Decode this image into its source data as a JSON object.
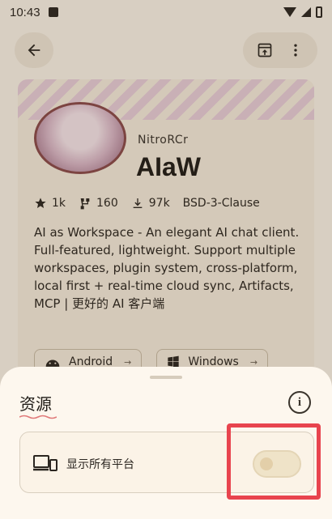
{
  "status_bar": {
    "time": "10:43",
    "icons": [
      "notification-icon",
      "wifi-icon",
      "signal-icon",
      "battery-icon"
    ]
  },
  "app_bar": {
    "back_icon": "arrow-left-icon",
    "actions": [
      "open-in-browser-icon",
      "more-vert-icon"
    ]
  },
  "repo": {
    "owner": "NitroRCr",
    "name": "AIaW",
    "stats": {
      "stars": "1k",
      "forks": "160",
      "downloads": "97k",
      "license": "BSD-3-Clause"
    },
    "description": "AI as Workspace - An elegant AI chat client. Full-featured, lightweight. Support multiple workspaces, plugin system, cross-platform, local first + real-time cloud sync, Artifacts, MCP | 更好的 AI 客户端",
    "platforms": [
      {
        "label": "Android",
        "arrow": "→"
      },
      {
        "label": "Windows",
        "arrow": "→"
      }
    ]
  },
  "sheet": {
    "title": "资源",
    "info_icon": "info-icon",
    "row_label": "显示所有平台",
    "toggle_on": false
  },
  "colors": {
    "background": "#fbf3e7",
    "sheet": "#fdf7ee",
    "highlight": "#e8444e",
    "accent": "#8a4a4a"
  }
}
